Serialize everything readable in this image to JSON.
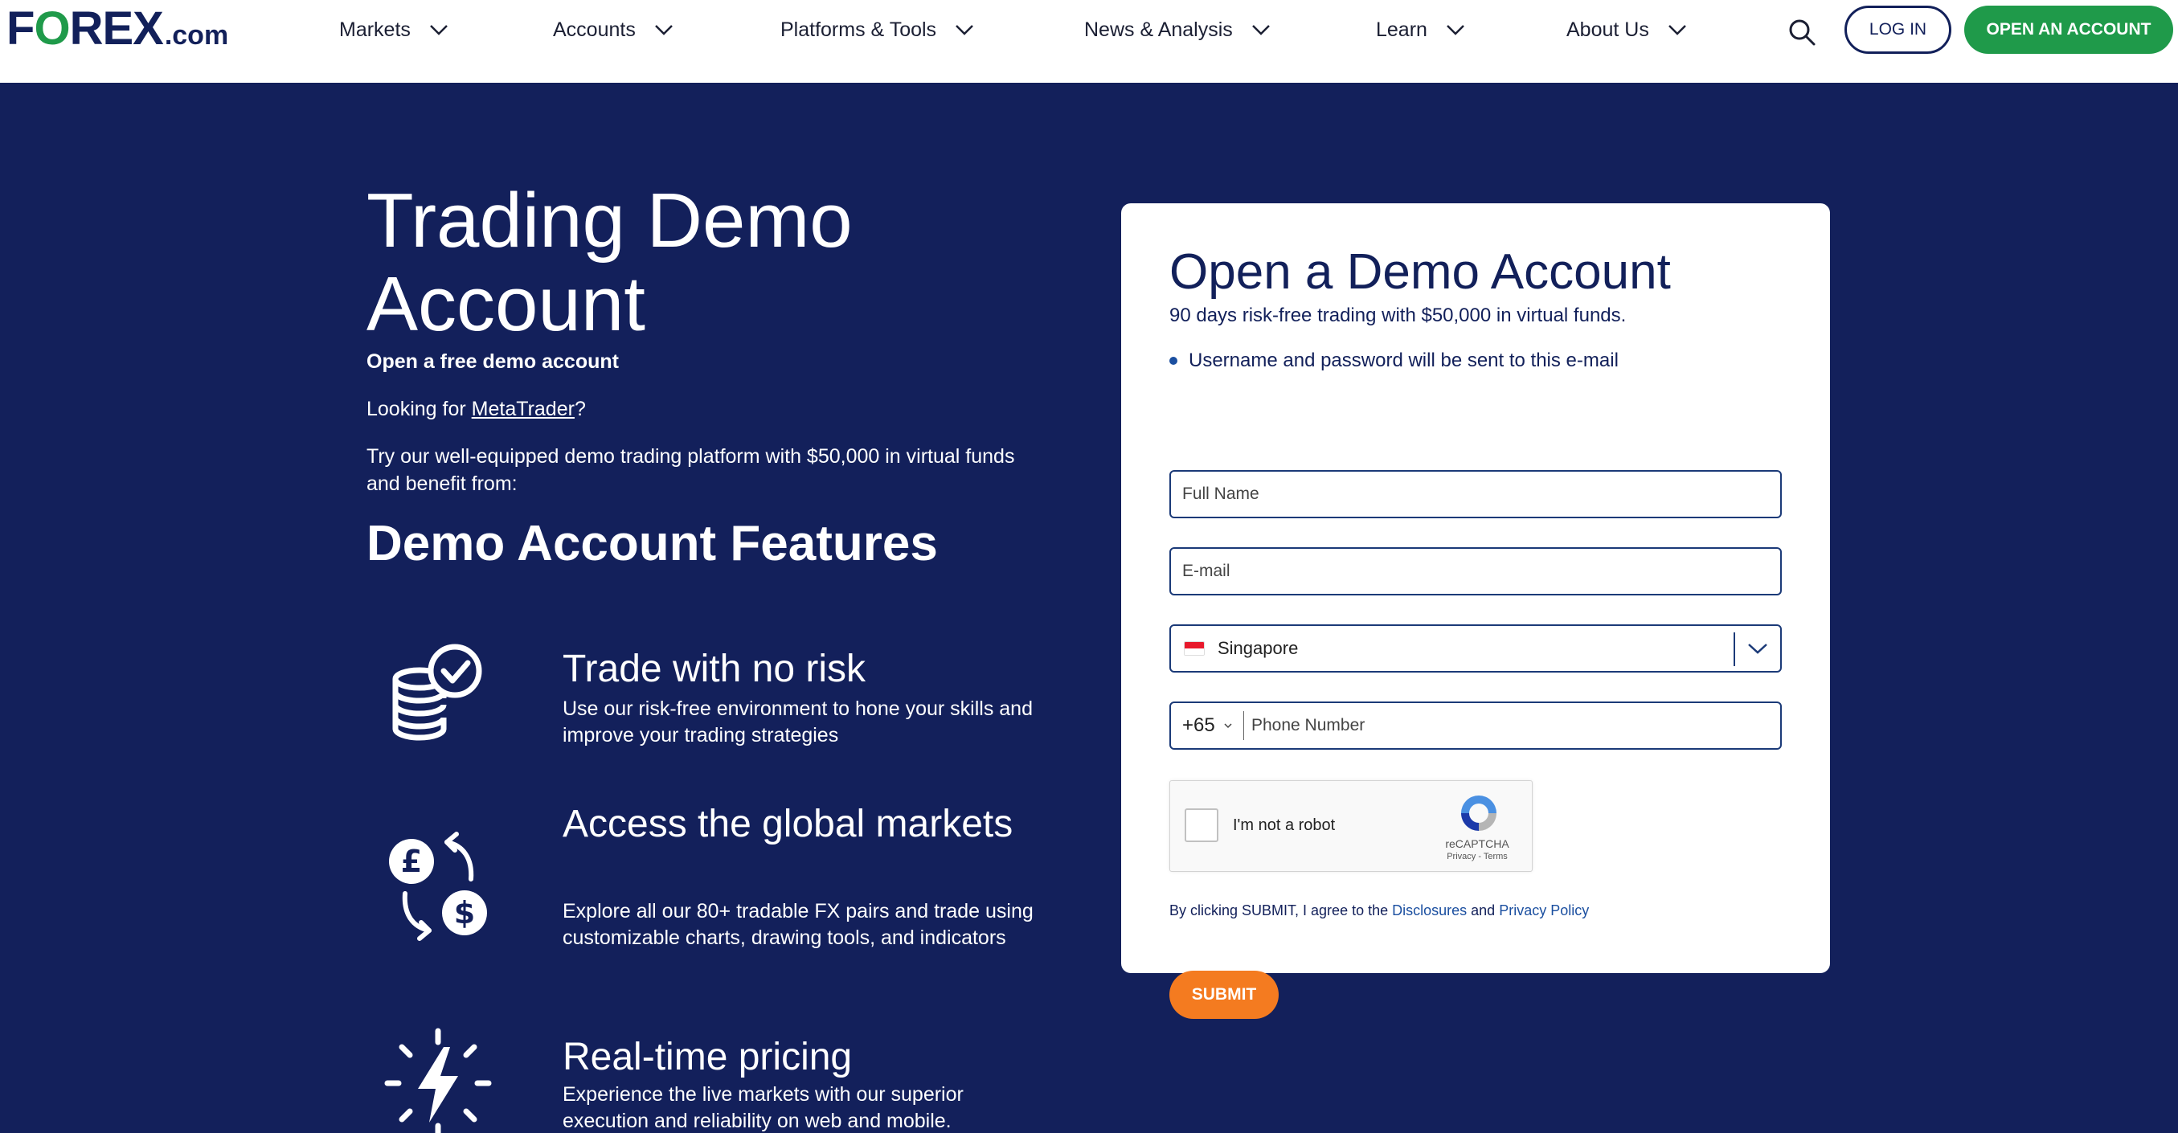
{
  "brand": {
    "logo_text_pre": "F",
    "logo_text_o": "O",
    "logo_text_post": "REX",
    "logo_suffix": ".com"
  },
  "nav": {
    "items": [
      {
        "label": "Markets"
      },
      {
        "label": "Accounts"
      },
      {
        "label": "Platforms & Tools"
      },
      {
        "label": "News & Analysis"
      },
      {
        "label": "Learn"
      },
      {
        "label": "About Us"
      }
    ],
    "login_label": "LOG IN",
    "open_account_label": "OPEN AN ACCOUNT"
  },
  "hero": {
    "title": "Trading Demo Account",
    "subtitle": "Open a free demo account",
    "looking_prefix": "Looking for ",
    "looking_link": "MetaTrader",
    "looking_suffix": "?",
    "try_text": "Try our well-equipped demo trading platform with $50,000 in virtual funds and benefit from:",
    "features_title": "Demo Account Features",
    "features": [
      {
        "icon": "coins-check-icon",
        "title": "Trade with no risk",
        "desc": "Use our risk-free environment to hone your skills and improve your trading strategies"
      },
      {
        "icon": "currency-exchange-icon",
        "title": "Access the global markets",
        "desc": "Explore all our 80+ tradable FX pairs and trade using customizable charts, drawing tools, and indicators"
      },
      {
        "icon": "lightning-icon",
        "title": "Real-time pricing",
        "desc": "Experience the live markets with our superior execution and reliability on web and mobile."
      }
    ]
  },
  "form": {
    "title": "Open a Demo Account",
    "subtitle": "90 days risk-free trading with $50,000 in virtual funds.",
    "note": "Username and password will be sent to this e-mail",
    "full_name_placeholder": "Full Name",
    "email_placeholder": "E-mail",
    "country": "Singapore",
    "phone_code": "+65",
    "phone_placeholder": "Phone Number",
    "captcha_label": "I'm not a robot",
    "captcha_brand": "reCAPTCHA",
    "captcha_links": "Privacy - Terms",
    "agree_prefix": "By clicking SUBMIT, I agree to the ",
    "agree_link1": "Disclosures",
    "agree_mid": " and ",
    "agree_link2": "Privacy Policy",
    "submit_label": "SUBMIT"
  },
  "colors": {
    "navy": "#13205b",
    "green": "#1f9a4a",
    "orange": "#f47b20",
    "link_blue": "#1b4fa0"
  }
}
